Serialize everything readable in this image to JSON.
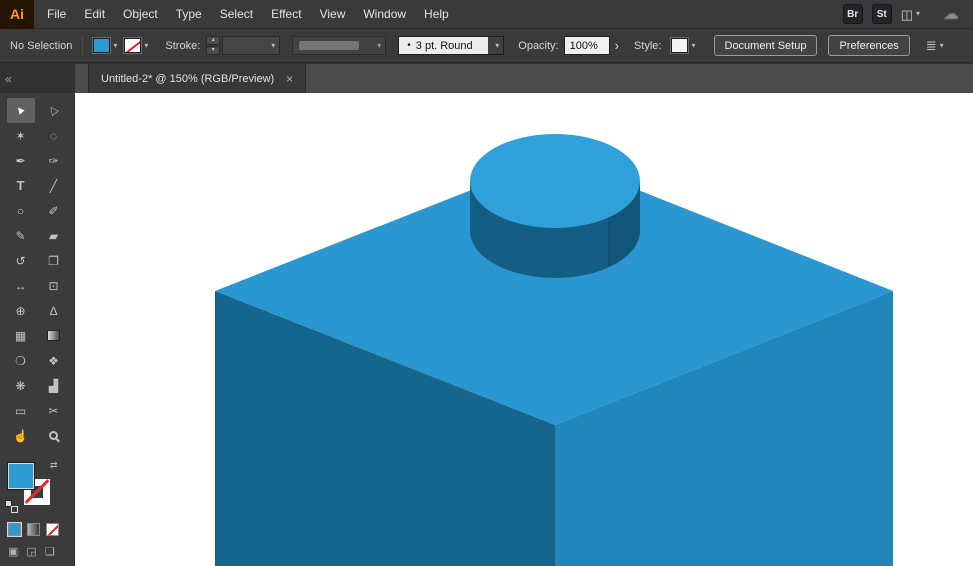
{
  "menubar": {
    "logo": "Ai",
    "items": [
      "File",
      "Edit",
      "Object",
      "Type",
      "Select",
      "Effect",
      "View",
      "Window",
      "Help"
    ],
    "bridge": "Br",
    "stock": "St"
  },
  "controlbar": {
    "selection_status": "No Selection",
    "stroke_label": "Stroke:",
    "brush_value": "3 pt. Round",
    "opacity_label": "Opacity:",
    "opacity_value": "100%",
    "style_label": "Style:",
    "document_setup_label": "Document Setup",
    "preferences_label": "Preferences"
  },
  "tabbar": {
    "title": "Untitled-2* @ 150% (RGB/Preview)"
  },
  "icons": {
    "caret": "▾",
    "chevron_right": "›",
    "swap": "⇄",
    "workspace": "◫",
    "cloud": "☁",
    "panel": "≣",
    "bullet": "•",
    "spin_up": "▴",
    "spin_down": "▾",
    "collapse": "«",
    "close": "×",
    "draw_normal": "▣",
    "draw_behind": "◲",
    "screen_mode": "❏"
  },
  "tools": [
    {
      "name": "selection",
      "glyph": "▲",
      "active": true
    },
    {
      "name": "direct-selection",
      "glyph": "△"
    },
    {
      "name": "magic-wand",
      "glyph": "✶"
    },
    {
      "name": "lasso",
      "glyph": "◌"
    },
    {
      "name": "pen",
      "glyph": "✒"
    },
    {
      "name": "curvature",
      "glyph": "✑"
    },
    {
      "name": "type",
      "glyph": "T"
    },
    {
      "name": "line-segment",
      "glyph": "╱"
    },
    {
      "name": "ellipse",
      "glyph": "○"
    },
    {
      "name": "paintbrush",
      "glyph": "✐"
    },
    {
      "name": "pencil",
      "glyph": "✎"
    },
    {
      "name": "eraser",
      "glyph": "▰"
    },
    {
      "name": "rotate",
      "glyph": "↺"
    },
    {
      "name": "scale",
      "glyph": "❐"
    },
    {
      "name": "width",
      "glyph": "↔"
    },
    {
      "name": "free-transform",
      "glyph": "⊡"
    },
    {
      "name": "shape-builder",
      "glyph": "⊕"
    },
    {
      "name": "perspective-grid",
      "glyph": "∆"
    },
    {
      "name": "mesh",
      "glyph": "▦"
    },
    {
      "name": "gradient",
      "glyph": ""
    },
    {
      "name": "eyedropper",
      "glyph": "❍"
    },
    {
      "name": "blend",
      "glyph": "❖"
    },
    {
      "name": "symbol-sprayer",
      "glyph": "❋"
    },
    {
      "name": "graph",
      "glyph": "▟"
    },
    {
      "name": "artboard",
      "glyph": "▭"
    },
    {
      "name": "slice",
      "glyph": "✂"
    },
    {
      "name": "hand",
      "glyph": "☝"
    },
    {
      "name": "zoom",
      "glyph": ""
    }
  ],
  "artwork": {
    "fill_color": "#2E9AD2",
    "brick_top": "#2B97D0",
    "brick_left": "#15658C",
    "brick_right": "#2187BB",
    "stud_top": "#2FA0D8",
    "stud_side": "#145E85",
    "stud_side_right": "#115678"
  }
}
